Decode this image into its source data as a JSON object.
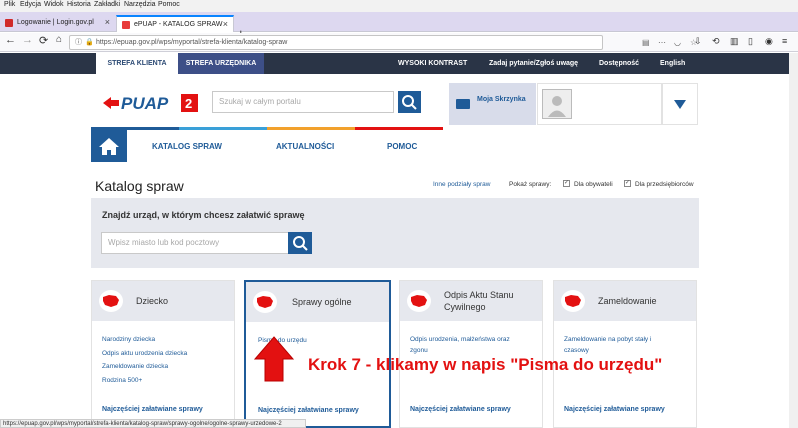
{
  "browser": {
    "menu": [
      "Plik",
      "Edycja",
      "Widok",
      "Historia",
      "Zakładki",
      "Narzędzia",
      "Pomoc"
    ],
    "tabs": [
      {
        "title": "Logowanie | Login.gov.pl"
      },
      {
        "title": "ePUAP - KATALOG SPRAW"
      }
    ],
    "url": "https://epuap.gov.pl/wps/myportal/strefa-klienta/katalog-spraw",
    "status_url": "https://epuap.gov.pl/wps/myportal/strefa-klienta/katalog-spraw/sprawy-ogolne/ogolne-sprawy-urzedowe-2"
  },
  "topnav": {
    "strefa_klienta": "STREFA KLIENTA",
    "strefa_urzednika": "STREFA URZĘDNIKA",
    "wysoki_kontrast": "WYSOKI KONTRAST",
    "zadaj_pytanie": "Zadaj pytanie/Zgłoś uwagę",
    "dostepnosc": "Dostępność",
    "english": "English"
  },
  "header": {
    "logo_text": "ePUAP",
    "logo_num": "2",
    "search_placeholder": "Szukaj w całym portalu",
    "mailbox_label": "Moja Skrzynka"
  },
  "mainnav": {
    "katalog": "KATALOG SPRAW",
    "aktualnosci": "AKTUALNOŚCI",
    "pomoc": "POMOC"
  },
  "page": {
    "title": "Katalog spraw",
    "inne_podzialy": "Inne podziały spraw",
    "pokaz_sprawy": "Pokaż sprawy:",
    "dla_obywateli": "Dla obywateli",
    "dla_przedsiebiorcow": "Dla przedsiębiorców"
  },
  "finder": {
    "label": "Znajdź urząd, w którym chcesz załatwić sprawę",
    "placeholder": "Wpisz miasto lub kod pocztowy"
  },
  "cards": [
    {
      "title": "Dziecko",
      "links": [
        "Narodziny dziecka",
        "Odpis aktu urodzenia dziecka",
        "Zameldowanie dziecka",
        "Rodzina 500+"
      ],
      "more": "Najczęściej załatwiane sprawy"
    },
    {
      "title": "Sprawy ogólne",
      "links": [
        "Pisma do urzędu"
      ],
      "more": "Najczęściej załatwiane sprawy"
    },
    {
      "title": "Odpis Aktu Stanu Cywilnego",
      "links": [
        "Odpis urodzenia, małżeństwa oraz",
        "zgonu"
      ],
      "more": "Najczęściej załatwiane sprawy"
    },
    {
      "title": "Zameldowanie",
      "links": [
        "Zameldowanie na pobyt stały i",
        "czasowy"
      ],
      "more": "Najczęściej załatwiane sprawy"
    }
  ],
  "annotation": {
    "text": "Krok 7 - klikamy w napis \"Pisma do urzędu\"",
    "color": "#e31111"
  },
  "colors": {
    "brand": "#1f5b98",
    "dark": "#2a3446",
    "accent": "#e31111"
  }
}
